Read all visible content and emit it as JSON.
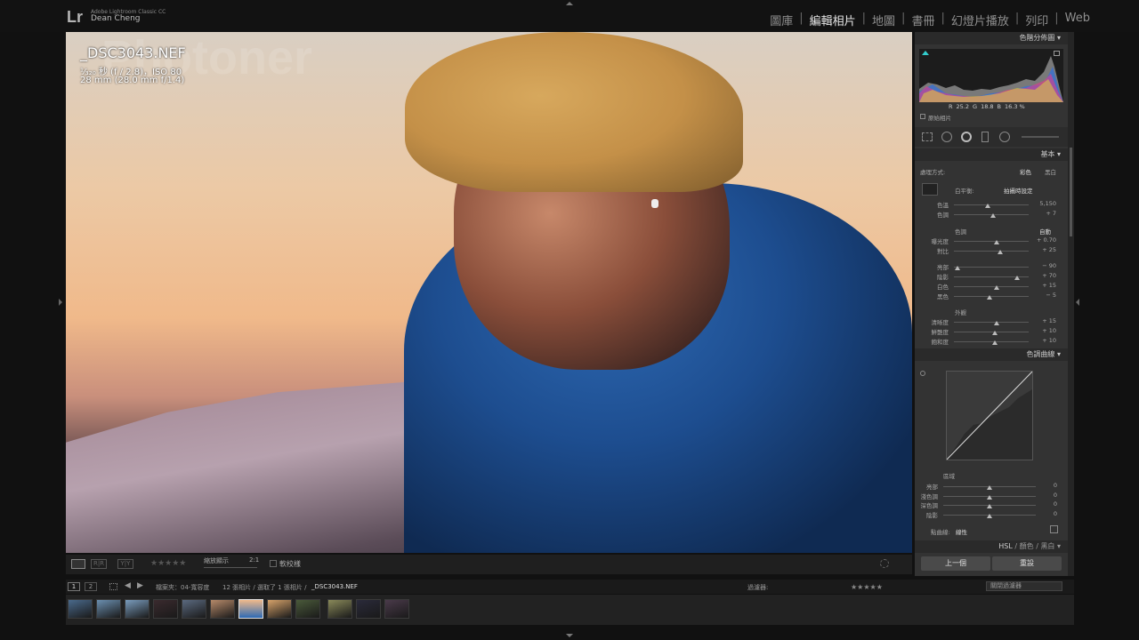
{
  "app": {
    "logo": "Lr",
    "name": "Adobe Lightroom Classic CC",
    "user": "Dean Cheng"
  },
  "modules": [
    "圖庫",
    "編輯相片",
    "地圖",
    "書冊",
    "幻燈片播放",
    "列印",
    "Web"
  ],
  "active_module": "編輯相片",
  "photo": {
    "watermark": "Photoner",
    "filename": "_DSC3043.NEF",
    "exposure_info": "¹⁄₃₂₀ 秒 (f / 2.8)，ISO 80",
    "lens_info": "28 mm (28.0 mm f/1.4)"
  },
  "toolbar": {
    "zoom_label": "縮放顯示",
    "zoom_ratio": "2:1",
    "softproof_label": "軟校樣",
    "stars": "★★★★★"
  },
  "histogram": {
    "title": "色階分佈圖",
    "r_label": "R",
    "r_value": "25.2",
    "g_label": "G",
    "g_value": "18.8",
    "b_label": "B",
    "b_value": "16.3 %",
    "original_label": "原始相片"
  },
  "basic": {
    "title": "基本",
    "treatment_label": "處理方式:",
    "treatment_color": "彩色",
    "treatment_bw": "黑白",
    "wb_label": "白平衡:",
    "wb_value": "拍攝時設定",
    "tone_label": "色調",
    "auto_label": "自動",
    "presence_label": "外觀",
    "sliders": [
      {
        "label": "色溫",
        "value": "5,150",
        "pos": 0.45
      },
      {
        "label": "色調",
        "value": "+ 7",
        "pos": 0.52
      },
      {
        "label": "曝光度",
        "value": "+ 0.70",
        "pos": 0.57
      },
      {
        "label": "對比",
        "value": "+ 25",
        "pos": 0.62
      },
      {
        "label": "亮部",
        "value": "− 90",
        "pos": 0.05
      },
      {
        "label": "陰影",
        "value": "+ 70",
        "pos": 0.85
      },
      {
        "label": "白色",
        "value": "+ 15",
        "pos": 0.57
      },
      {
        "label": "黑色",
        "value": "− 5",
        "pos": 0.48
      },
      {
        "label": "清晰度",
        "value": "+ 15",
        "pos": 0.57
      },
      {
        "label": "鮮艷度",
        "value": "+ 10",
        "pos": 0.55
      },
      {
        "label": "飽和度",
        "value": "+ 10",
        "pos": 0.55
      }
    ]
  },
  "tone_curve": {
    "title": "色調曲線",
    "region_label": "區域",
    "channel_label": "點曲線:",
    "channel_value": "線性",
    "regions": [
      {
        "label": "亮部",
        "value": "0"
      },
      {
        "label": "淺色調",
        "value": "0"
      },
      {
        "label": "深色調",
        "value": "0"
      },
      {
        "label": "陰影",
        "value": "0"
      }
    ]
  },
  "hsl": {
    "hsl": "HSL",
    "sep": "/",
    "color": "顏色",
    "bw": "黑白"
  },
  "buttons": {
    "prev": "上一個",
    "reset": "重設"
  },
  "filmbar": {
    "page1": "1",
    "page2": "2",
    "source": "檔案夾：04-寬容度",
    "count": "12 張相片 / 選取了 1 張相片 /",
    "selected": "_DSC3043.NEF",
    "filter_label": "過濾器:",
    "filter_value": "關閉過濾器"
  },
  "filmstrip_count": 12
}
